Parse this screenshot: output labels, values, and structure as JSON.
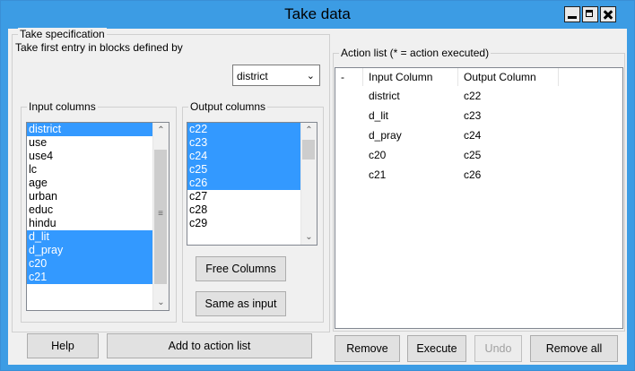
{
  "window": {
    "title": "Take data"
  },
  "spec": {
    "group_label": "Take specification",
    "take_first_label": "Take first entry in blocks defined by",
    "block_var": "district",
    "input_label": "Input columns",
    "output_label": "Output columns",
    "input_columns": [
      {
        "name": "district",
        "selected": true
      },
      {
        "name": "use",
        "selected": false
      },
      {
        "name": "use4",
        "selected": false
      },
      {
        "name": "lc",
        "selected": false
      },
      {
        "name": "age",
        "selected": false
      },
      {
        "name": "urban",
        "selected": false
      },
      {
        "name": "educ",
        "selected": false
      },
      {
        "name": "hindu",
        "selected": false
      },
      {
        "name": "d_lit",
        "selected": true
      },
      {
        "name": "d_pray",
        "selected": true
      },
      {
        "name": "c20",
        "selected": true
      },
      {
        "name": "c21",
        "selected": true
      }
    ],
    "output_columns": [
      {
        "name": "c22",
        "selected": true
      },
      {
        "name": "c23",
        "selected": true
      },
      {
        "name": "c24",
        "selected": true
      },
      {
        "name": "c25",
        "selected": true
      },
      {
        "name": "c26",
        "selected": true
      },
      {
        "name": "c27",
        "selected": false
      },
      {
        "name": "c28",
        "selected": false
      },
      {
        "name": "c29",
        "selected": false
      }
    ],
    "free_columns": "Free Columns",
    "same_as_input": "Same as input"
  },
  "actions": {
    "group_label": "Action list (* = action executed)",
    "headers": {
      "flag": "-",
      "input": "Input Column",
      "output": "Output Column"
    },
    "rows": [
      {
        "input": "district",
        "output": "c22"
      },
      {
        "input": "d_lit",
        "output": "c23"
      },
      {
        "input": "d_pray",
        "output": "c24"
      },
      {
        "input": "c20",
        "output": "c25"
      },
      {
        "input": "c21",
        "output": "c26"
      }
    ],
    "remove": "Remove",
    "execute": "Execute",
    "undo": "Undo",
    "remove_all": "Remove all"
  },
  "footer": {
    "help": "Help",
    "add": "Add to action list"
  }
}
